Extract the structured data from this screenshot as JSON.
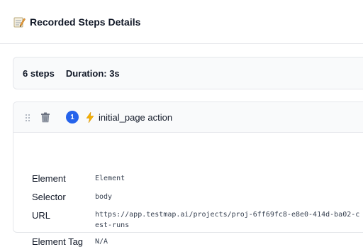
{
  "header": {
    "icon": "memo-icon",
    "title": "Recorded Steps Details"
  },
  "summary": {
    "steps": "6 steps",
    "duration": "Duration: 3s"
  },
  "step": {
    "number": "1",
    "icon": "lightning-icon",
    "title": "initial_page action",
    "badge_color": "#2563eb",
    "fields": {
      "element_label": "Element",
      "element_value": "Element",
      "selector_label": "Selector",
      "selector_value": "body",
      "url_label": "URL",
      "url_value_line1": "https://app.testmap.ai/projects/proj-6ff69fc8-e8e0-414d-ba02-c",
      "url_value_line2": "est-runs",
      "tag_label": "Element Tag",
      "tag_value": "N/A"
    }
  }
}
